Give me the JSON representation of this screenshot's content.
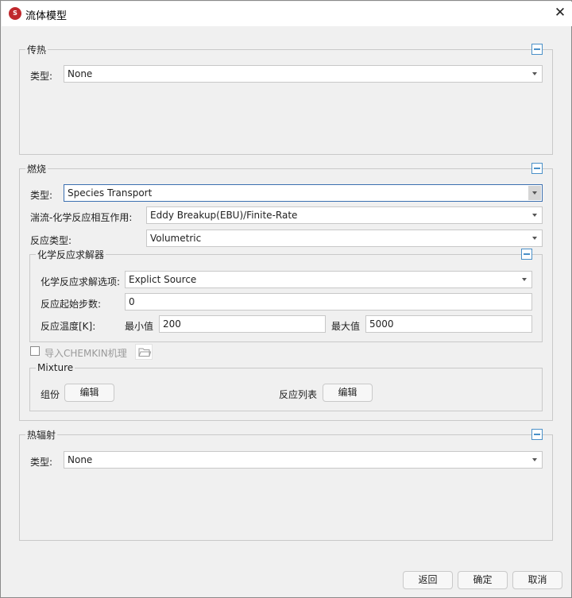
{
  "window": {
    "title": "流体模型",
    "app_icon_text": "S",
    "close_glyph": "✕"
  },
  "heat_transfer": {
    "label": "传热",
    "type_label": "类型:",
    "type_value": "None"
  },
  "combustion": {
    "label": "燃烧",
    "type_label": "类型:",
    "type_value": "Species Transport",
    "turb_label": "湍流-化学反应相互作用:",
    "turb_value": "Eddy Breakup(EBU)/Finite-Rate",
    "reaction_type_label": "反应类型:",
    "reaction_type_value": "Volumetric",
    "solver": {
      "label": "化学反应求解器",
      "option_label": "化学反应求解选项:",
      "option_value": "Explict Source",
      "start_step_label": "反应起始步数:",
      "start_step_value": "0",
      "temp_label": "反应温度[K]:",
      "min_label": "最小值",
      "min_value": "200",
      "max_label": "最大值",
      "max_value": "5000"
    },
    "import_chemkin_label": "导入CHEMKIN机理",
    "import_chemkin_checked": false,
    "mixture": {
      "label": "Mixture",
      "species_label": "组份",
      "species_edit": "编辑",
      "reactions_label": "反应列表",
      "reactions_edit": "编辑"
    }
  },
  "radiation": {
    "label": "热辐射",
    "type_label": "类型:",
    "type_value": "None"
  },
  "footer": {
    "back": "返回",
    "ok": "确定",
    "cancel": "取消"
  },
  "colors": {
    "accent": "#4a90c8",
    "focus_border": "#3b6fb0",
    "background": "#f0f0f0",
    "app_icon": "#c0282d"
  },
  "icons": [
    "app-icon",
    "close-icon",
    "collapse-icon",
    "dropdown-arrow-icon",
    "folder-icon"
  ]
}
